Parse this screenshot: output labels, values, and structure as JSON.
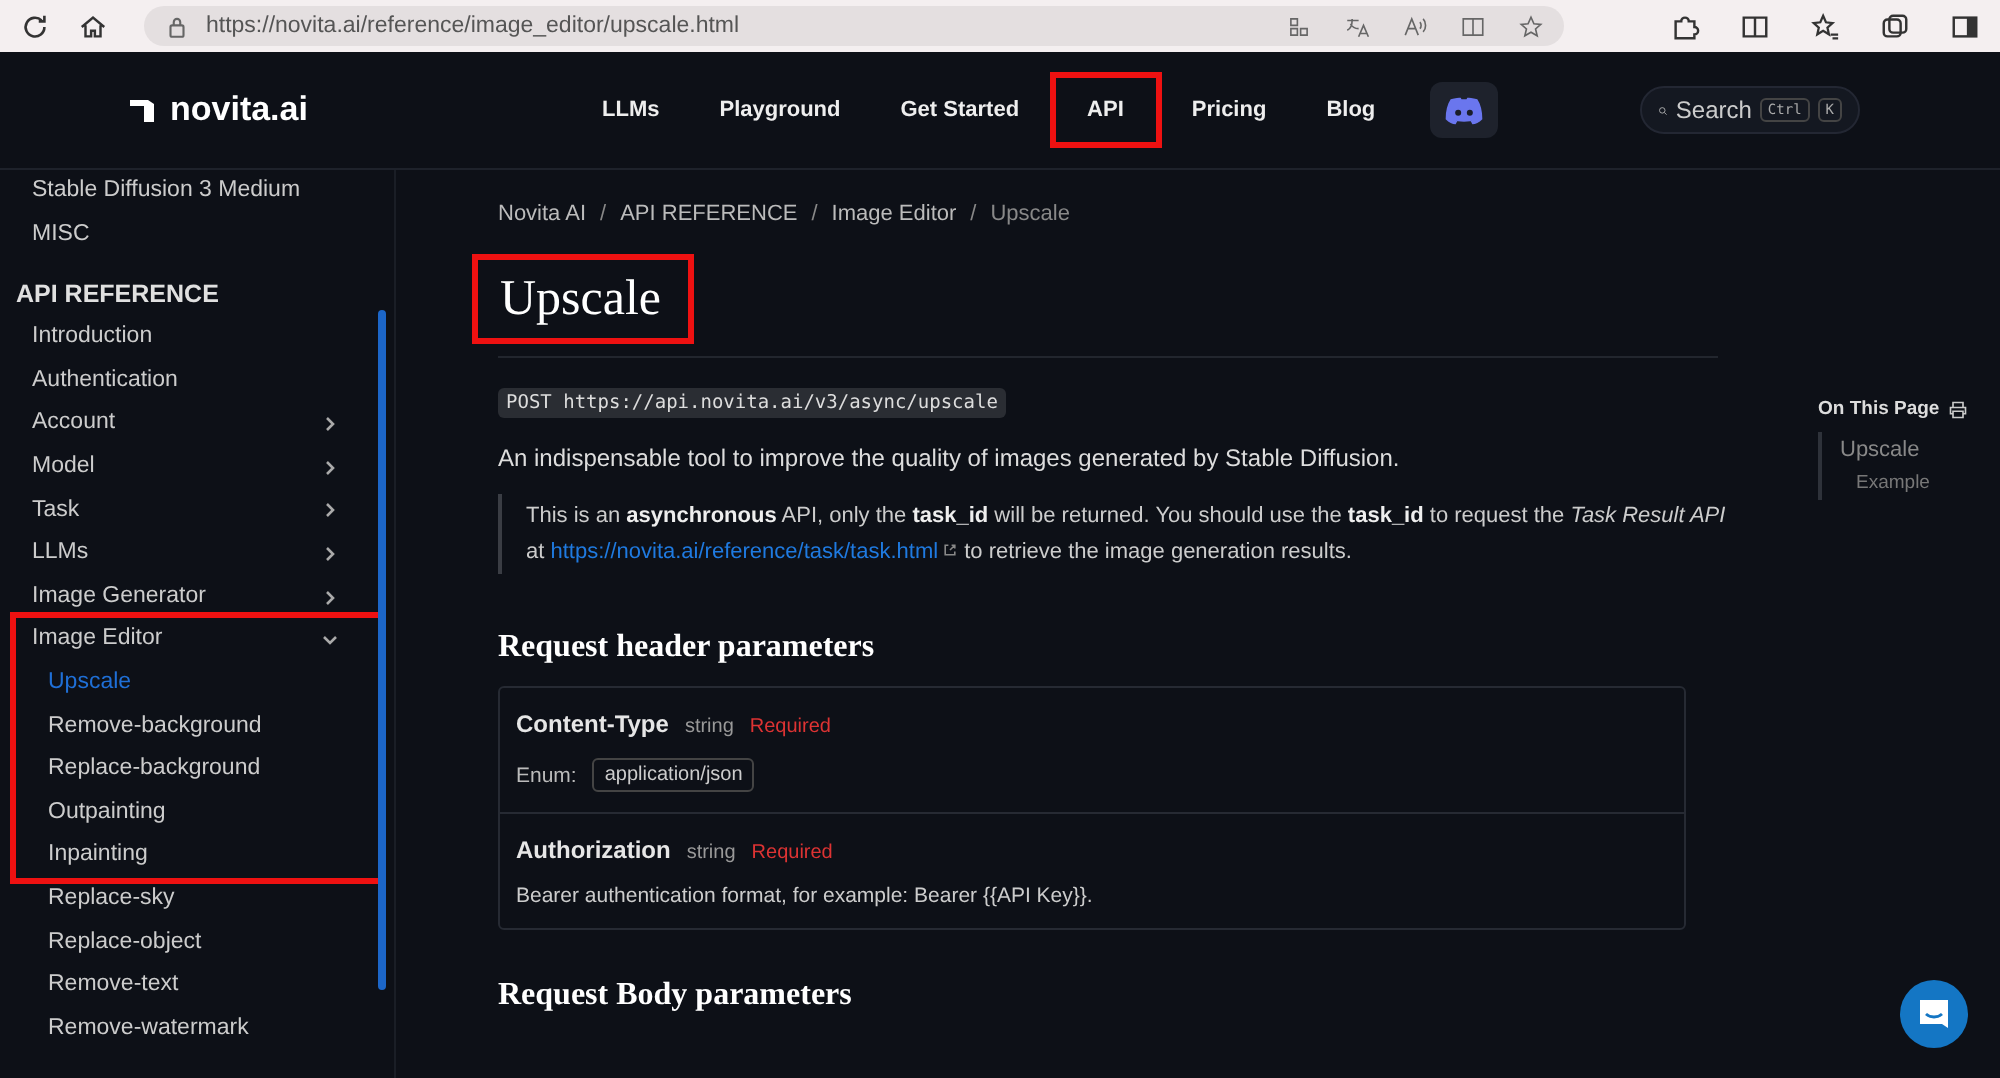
{
  "browser": {
    "url": "https://novita.ai/reference/image_editor/upscale.html"
  },
  "header": {
    "logo": "novita.ai",
    "nav": [
      {
        "label": "LLMs",
        "highlighted": false
      },
      {
        "label": "Playground",
        "highlighted": false
      },
      {
        "label": "Get Started",
        "highlighted": false
      },
      {
        "label": "API",
        "highlighted": true
      },
      {
        "label": "Pricing",
        "highlighted": false
      },
      {
        "label": "Blog",
        "highlighted": false
      }
    ],
    "search": {
      "label": "Search",
      "keys": [
        "Ctrl",
        "K"
      ]
    }
  },
  "sidebar": {
    "items": [
      {
        "kind": "link",
        "label": "Stable Diffusion 3 Medium"
      },
      {
        "kind": "link",
        "label": "MISC"
      },
      {
        "kind": "heading",
        "label": "API REFERENCE"
      },
      {
        "kind": "link",
        "label": "Introduction"
      },
      {
        "kind": "link",
        "label": "Authentication"
      },
      {
        "kind": "group",
        "label": "Account",
        "expanded": false
      },
      {
        "kind": "group",
        "label": "Model",
        "expanded": false
      },
      {
        "kind": "group",
        "label": "Task",
        "expanded": false
      },
      {
        "kind": "group",
        "label": "LLMs",
        "expanded": false
      },
      {
        "kind": "group",
        "label": "Image Generator",
        "expanded": false
      },
      {
        "kind": "group",
        "label": "Image Editor",
        "expanded": true,
        "highlighted": true,
        "children": [
          {
            "label": "Upscale",
            "selected": true,
            "highlighted": true
          },
          {
            "label": "Remove-background",
            "selected": false,
            "highlighted": true
          },
          {
            "label": "Replace-background",
            "selected": false,
            "highlighted": true
          },
          {
            "label": "Outpainting",
            "selected": false,
            "highlighted": true
          },
          {
            "label": "Inpainting",
            "selected": false,
            "highlighted": true
          },
          {
            "label": "Replace-sky",
            "selected": false,
            "highlighted": false
          },
          {
            "label": "Replace-object",
            "selected": false,
            "highlighted": false
          },
          {
            "label": "Remove-text",
            "selected": false,
            "highlighted": false
          },
          {
            "label": "Remove-watermark",
            "selected": false,
            "highlighted": false
          }
        ]
      }
    ]
  },
  "breadcrumb": {
    "separator": "/",
    "items": [
      "Novita AI",
      "API REFERENCE",
      "Image Editor",
      "Upscale"
    ]
  },
  "title": {
    "text": "Upscale",
    "highlighted": true
  },
  "endpoint": "POST https://api.novita.ai/v3/async/upscale",
  "lead": "An indispensable tool to improve the quality of images generated by Stable Diffusion.",
  "note": {
    "before": "This is an **asynchronous** API, only the **task_id** will be returned. You should use the **task_id** to request the *Task Result API* at",
    "link": "https://novita.ai/reference/task/task.html",
    "after": "to retrieve the image generation results."
  },
  "header_params": {
    "title": "Request header parameters",
    "params": [
      {
        "name": "Content-Type",
        "type": "string",
        "required": "Required",
        "enum_label": "Enum:",
        "enum": "application/json"
      },
      {
        "name": "Authorization",
        "type": "string",
        "required": "Required",
        "description": "Bearer authentication format, for example: Bearer {{API Key}}."
      }
    ]
  },
  "body_params": {
    "title": "Request Body parameters"
  },
  "toc": {
    "title": "On This Page",
    "items": [
      {
        "label": "Upscale",
        "children": [
          {
            "label": "Example"
          }
        ]
      }
    ]
  }
}
